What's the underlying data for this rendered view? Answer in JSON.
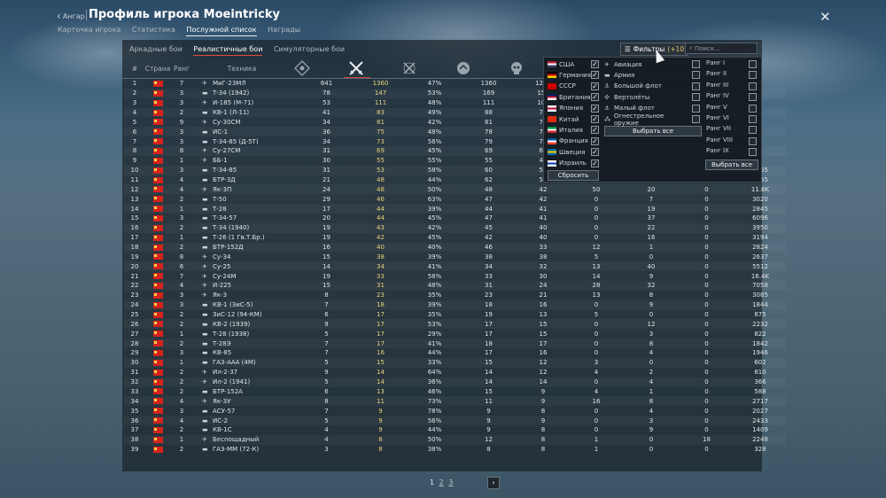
{
  "header": {
    "back_label": "Ангар",
    "title": "Профиль игрока Moeintricky"
  },
  "tabs": [
    "Карточка игрока",
    "Статистика",
    "Послужной список",
    "Награды"
  ],
  "modes": [
    "Аркадные бои",
    "Реалистичные бои",
    "Симуляторные бои"
  ],
  "filter": {
    "label": "Фильтры",
    "count": "(+10)"
  },
  "search": {
    "placeholder": "Поиск..."
  },
  "columns": {
    "num": "#",
    "country": "Страна",
    "rank": "Ранг",
    "vehicle": "Техника"
  },
  "countries": [
    {
      "name": "США",
      "colors": [
        "#b22234",
        "#ffffff",
        "#3c3b6e"
      ]
    },
    {
      "name": "Германия",
      "colors": [
        "#000000",
        "#dd0000",
        "#ffce00"
      ]
    },
    {
      "name": "СССР",
      "colors": [
        "#cc0000",
        "#cc0000",
        "#cc0000"
      ]
    },
    {
      "name": "Британия",
      "colors": [
        "#012169",
        "#c8102e",
        "#ffffff"
      ]
    },
    {
      "name": "Япония",
      "colors": [
        "#ffffff",
        "#bc002d",
        "#ffffff"
      ]
    },
    {
      "name": "Китай",
      "colors": [
        "#de2910",
        "#de2910",
        "#de2910"
      ]
    },
    {
      "name": "Италия",
      "colors": [
        "#009246",
        "#ffffff",
        "#ce2b37"
      ]
    },
    {
      "name": "Франция",
      "colors": [
        "#0055a4",
        "#ffffff",
        "#ef4135"
      ]
    },
    {
      "name": "Швеция",
      "colors": [
        "#006aa7",
        "#fecc00",
        "#006aa7"
      ]
    },
    {
      "name": "Израиль",
      "colors": [
        "#ffffff",
        "#0038b8",
        "#ffffff"
      ]
    }
  ],
  "vehicle_types": [
    "Авиация",
    "Армия",
    "Большой флот",
    "Вертолёты",
    "Малый флот",
    "Огнестрельное оружие"
  ],
  "ranks": [
    "Ранг I",
    "Ранг II",
    "Ранг III",
    "Ранг IV",
    "Ранг V",
    "Ранг VI",
    "Ранг VII",
    "Ранг VIII",
    "Ранг IX"
  ],
  "buttons": {
    "select_all": "Выбрать все",
    "reset": "Сбросить",
    "select_all_ranks": "Выбрать все"
  },
  "pager": {
    "current": "1",
    "pages": [
      "2",
      "3"
    ],
    "next": "›"
  },
  "rows": [
    [
      "1",
      "7",
      "МиГ-23МЛ",
      "641",
      "1360",
      "47%",
      "1360",
      "1217",
      "",
      "",
      "",
      ""
    ],
    [
      "2",
      "3",
      "Т-34 (1942)",
      "78",
      "147",
      "53%",
      "169",
      "156",
      "",
      "",
      "",
      ""
    ],
    [
      "3",
      "3",
      "И-185 (М-71)",
      "53",
      "111",
      "48%",
      "111",
      "103",
      "",
      "",
      "",
      ""
    ],
    [
      "4",
      "2",
      "КВ-1 (Л-11)",
      "41",
      "83",
      "49%",
      "88",
      "79",
      "",
      "",
      "",
      ""
    ],
    [
      "5",
      "9",
      "Су-30СМ",
      "34",
      "81",
      "42%",
      "81",
      "78",
      "",
      "",
      "",
      ""
    ],
    [
      "6",
      "3",
      "ИС-1",
      "36",
      "75",
      "48%",
      "78",
      "74",
      "",
      "",
      "",
      ""
    ],
    [
      "7",
      "3",
      "Т-34-85 (Д-5Т)",
      "34",
      "73",
      "56%",
      "79",
      "74",
      "",
      "",
      "",
      ""
    ],
    [
      "8",
      "8",
      "Су-27СМ",
      "31",
      "69",
      "45%",
      "69",
      "68",
      "",
      "",
      "",
      ""
    ],
    [
      "9",
      "1",
      "ББ-1",
      "30",
      "55",
      "55%",
      "55",
      "44",
      "",
      "",
      "",
      ""
    ],
    [
      "10",
      "3",
      "Т-34-85",
      "31",
      "53",
      "58%",
      "60",
      "55",
      "",
      "",
      "",
      "8555"
    ],
    [
      "11",
      "4",
      "БТР-3Д",
      "21",
      "48",
      "44%",
      "62",
      "54",
      "11",
      "17",
      "0",
      "8355"
    ],
    [
      "12",
      "4",
      "Як-3П",
      "24",
      "48",
      "50%",
      "48",
      "42",
      "50",
      "20",
      "0",
      "11.6K"
    ],
    [
      "13",
      "2",
      "Т-50",
      "29",
      "46",
      "63%",
      "47",
      "42",
      "0",
      "7",
      "0",
      "3020"
    ],
    [
      "14",
      "1",
      "Т-28",
      "17",
      "44",
      "39%",
      "44",
      "41",
      "0",
      "19",
      "0",
      "2845"
    ],
    [
      "15",
      "3",
      "Т-34-57",
      "20",
      "44",
      "45%",
      "47",
      "41",
      "0",
      "37",
      "0",
      "6096"
    ],
    [
      "16",
      "2",
      "Т-34 (1940)",
      "19",
      "43",
      "42%",
      "45",
      "40",
      "0",
      "22",
      "0",
      "3950"
    ],
    [
      "17",
      "1",
      "Т-26 (1 Гв.Т.Бр.)",
      "19",
      "42",
      "45%",
      "42",
      "40",
      "0",
      "16",
      "0",
      "3194"
    ],
    [
      "18",
      "2",
      "БТР-152Д",
      "16",
      "40",
      "40%",
      "46",
      "33",
      "12",
      "1",
      "0",
      "2824"
    ],
    [
      "19",
      "8",
      "Су-34",
      "15",
      "38",
      "39%",
      "38",
      "38",
      "5",
      "0",
      "0",
      "2637"
    ],
    [
      "20",
      "6",
      "Су-25",
      "14",
      "34",
      "41%",
      "34",
      "32",
      "13",
      "40",
      "0",
      "5512"
    ],
    [
      "21",
      "7",
      "Су-24М",
      "19",
      "33",
      "58%",
      "33",
      "30",
      "14",
      "9",
      "0",
      "16.4K"
    ],
    [
      "22",
      "4",
      "И-225",
      "15",
      "31",
      "48%",
      "31",
      "24",
      "28",
      "32",
      "0",
      "7058"
    ],
    [
      "23",
      "3",
      "Як-3",
      "8",
      "23",
      "35%",
      "23",
      "21",
      "13",
      "8",
      "0",
      "3085"
    ],
    [
      "24",
      "3",
      "КВ-1 (ЗиС-5)",
      "7",
      "18",
      "39%",
      "18",
      "16",
      "0",
      "9",
      "0",
      "1844"
    ],
    [
      "25",
      "2",
      "ЗиС-12 (94-КМ)",
      "6",
      "17",
      "35%",
      "19",
      "13",
      "5",
      "0",
      "0",
      "875"
    ],
    [
      "26",
      "2",
      "КВ-2 (1939)",
      "9",
      "17",
      "53%",
      "17",
      "15",
      "0",
      "12",
      "0",
      "2232"
    ],
    [
      "27",
      "1",
      "Т-28 (1938)",
      "5",
      "17",
      "29%",
      "17",
      "15",
      "0",
      "3",
      "0",
      "822"
    ],
    [
      "28",
      "2",
      "Т-28Э",
      "7",
      "17",
      "41%",
      "18",
      "17",
      "0",
      "8",
      "0",
      "1842"
    ],
    [
      "29",
      "3",
      "КВ-85",
      "7",
      "16",
      "44%",
      "17",
      "16",
      "0",
      "4",
      "0",
      "1946"
    ],
    [
      "30",
      "1",
      "ГАЗ-ААА (4М)",
      "5",
      "15",
      "33%",
      "15",
      "12",
      "3",
      "0",
      "0",
      "602"
    ],
    [
      "31",
      "2",
      "Ил-2-37",
      "9",
      "14",
      "64%",
      "14",
      "12",
      "4",
      "2",
      "0",
      "810"
    ],
    [
      "32",
      "2",
      "Ил-2 (1941)",
      "5",
      "14",
      "36%",
      "14",
      "14",
      "0",
      "4",
      "0",
      "366"
    ],
    [
      "33",
      "2",
      "БТР-152А",
      "6",
      "13",
      "46%",
      "15",
      "9",
      "4",
      "1",
      "0",
      "588"
    ],
    [
      "34",
      "4",
      "Як-3У",
      "8",
      "11",
      "73%",
      "11",
      "9",
      "16",
      "8",
      "0",
      "2717"
    ],
    [
      "35",
      "3",
      "АСУ-57",
      "7",
      "9",
      "78%",
      "9",
      "8",
      "0",
      "4",
      "0",
      "2027"
    ],
    [
      "36",
      "4",
      "ИС-2",
      "5",
      "9",
      "56%",
      "9",
      "9",
      "0",
      "3",
      "0",
      "2433"
    ],
    [
      "37",
      "2",
      "КВ-1С",
      "4",
      "9",
      "44%",
      "9",
      "8",
      "0",
      "9",
      "0",
      "1409"
    ],
    [
      "38",
      "1",
      "Беспощадный",
      "4",
      "8",
      "50%",
      "12",
      "8",
      "1",
      "0",
      "18",
      "2248"
    ],
    [
      "39",
      "2",
      "ГАЗ-ММ (72-К)",
      "3",
      "8",
      "38%",
      "8",
      "8",
      "1",
      "0",
      "0",
      "328"
    ]
  ]
}
